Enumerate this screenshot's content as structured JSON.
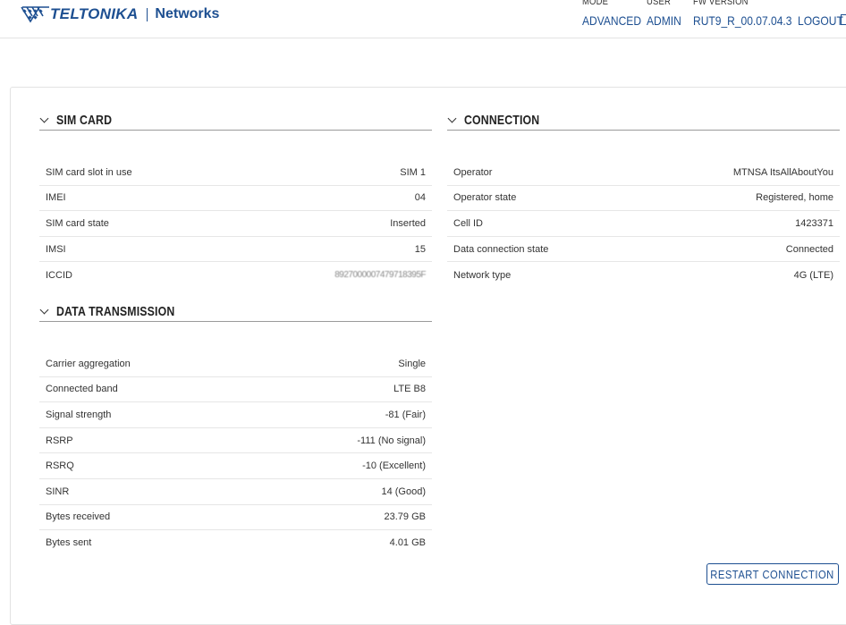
{
  "header": {
    "brand": "TELTONIKA",
    "brand_sub": "Networks",
    "mode_caption": "MODE",
    "mode_value": "ADVANCED",
    "user_caption": "USER",
    "user_value": "ADMIN",
    "fw_caption": "FW VERSION",
    "fw_value": "RUT9_R_00.07.04.3",
    "logout_label": "LOGOUT"
  },
  "sim_card": {
    "title": "SIM CARD",
    "rows": [
      {
        "label": "SIM card slot in use",
        "value": "SIM 1"
      },
      {
        "label": "IMEI",
        "value": "04"
      },
      {
        "label": "SIM card state",
        "value": "Inserted"
      },
      {
        "label": "IMSI",
        "value": "15"
      },
      {
        "label": "ICCID",
        "value": "8927000007479718395F"
      }
    ]
  },
  "connection": {
    "title": "CONNECTION",
    "rows": [
      {
        "label": "Operator",
        "value": "MTNSA ItsAllAboutYou"
      },
      {
        "label": "Operator state",
        "value": "Registered, home"
      },
      {
        "label": "Cell ID",
        "value": "1423371"
      },
      {
        "label": "Data connection state",
        "value": "Connected"
      },
      {
        "label": "Network type",
        "value": "4G (LTE)"
      }
    ]
  },
  "data_transmission": {
    "title": "DATA TRANSMISSION",
    "rows": [
      {
        "label": "Carrier aggregation",
        "value": "Single"
      },
      {
        "label": "Connected band",
        "value": "LTE B8"
      },
      {
        "label": "Signal strength",
        "value": "-81 (Fair)"
      },
      {
        "label": "RSRP",
        "value": "-111 (No signal)"
      },
      {
        "label": "RSRQ",
        "value": "-10 (Excellent)"
      },
      {
        "label": "SINR",
        "value": "14 (Good)"
      },
      {
        "label": "Bytes received",
        "value": "23.79 GB"
      },
      {
        "label": "Bytes sent",
        "value": "4.01 GB"
      }
    ]
  },
  "actions": {
    "restart_label": "RESTART CONNECTION"
  },
  "colors": {
    "brand_blue": "#1d4f91",
    "divider": "#e6e6e6"
  }
}
